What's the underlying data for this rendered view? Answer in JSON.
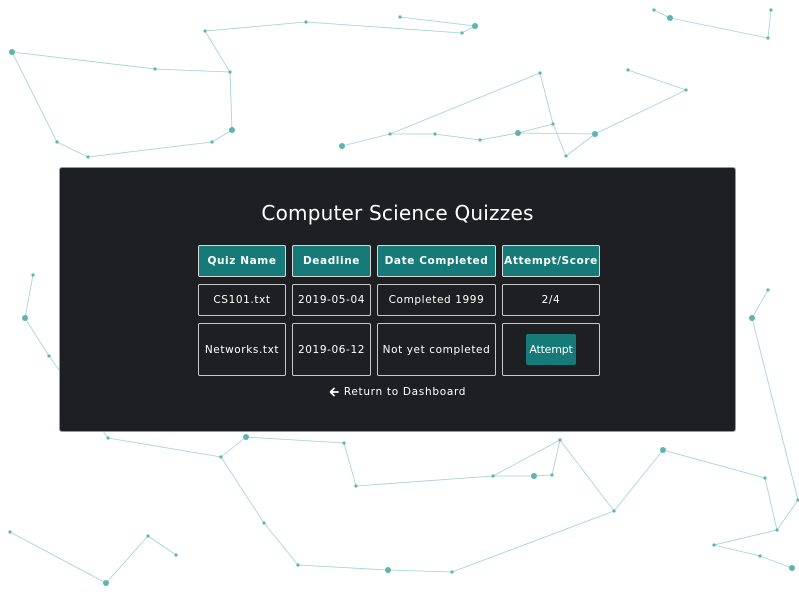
{
  "page": {
    "title": "Computer Science Quizzes"
  },
  "table": {
    "headers": [
      "Quiz Name",
      "Deadline",
      "Date Completed",
      "Attempt/Score"
    ],
    "rows": [
      {
        "quiz_name": "CS101.txt",
        "deadline": "2019-05-04",
        "date_completed": "Completed 1999",
        "attempt_score": "2/4"
      },
      {
        "quiz_name": "Networks.txt",
        "deadline": "2019-06-12",
        "date_completed": "Not yet completed",
        "attempt_button_label": "Attempt"
      }
    ]
  },
  "footer": {
    "return_label": "Return to Dashboard",
    "return_icon": "arrow-left-icon"
  },
  "colors": {
    "accent": "#157a78",
    "panel_bg": "#1e1f22",
    "panel_border": "#4fb6b1",
    "network_line": "#9fd3d1",
    "network_node": "#5fb3b3"
  }
}
